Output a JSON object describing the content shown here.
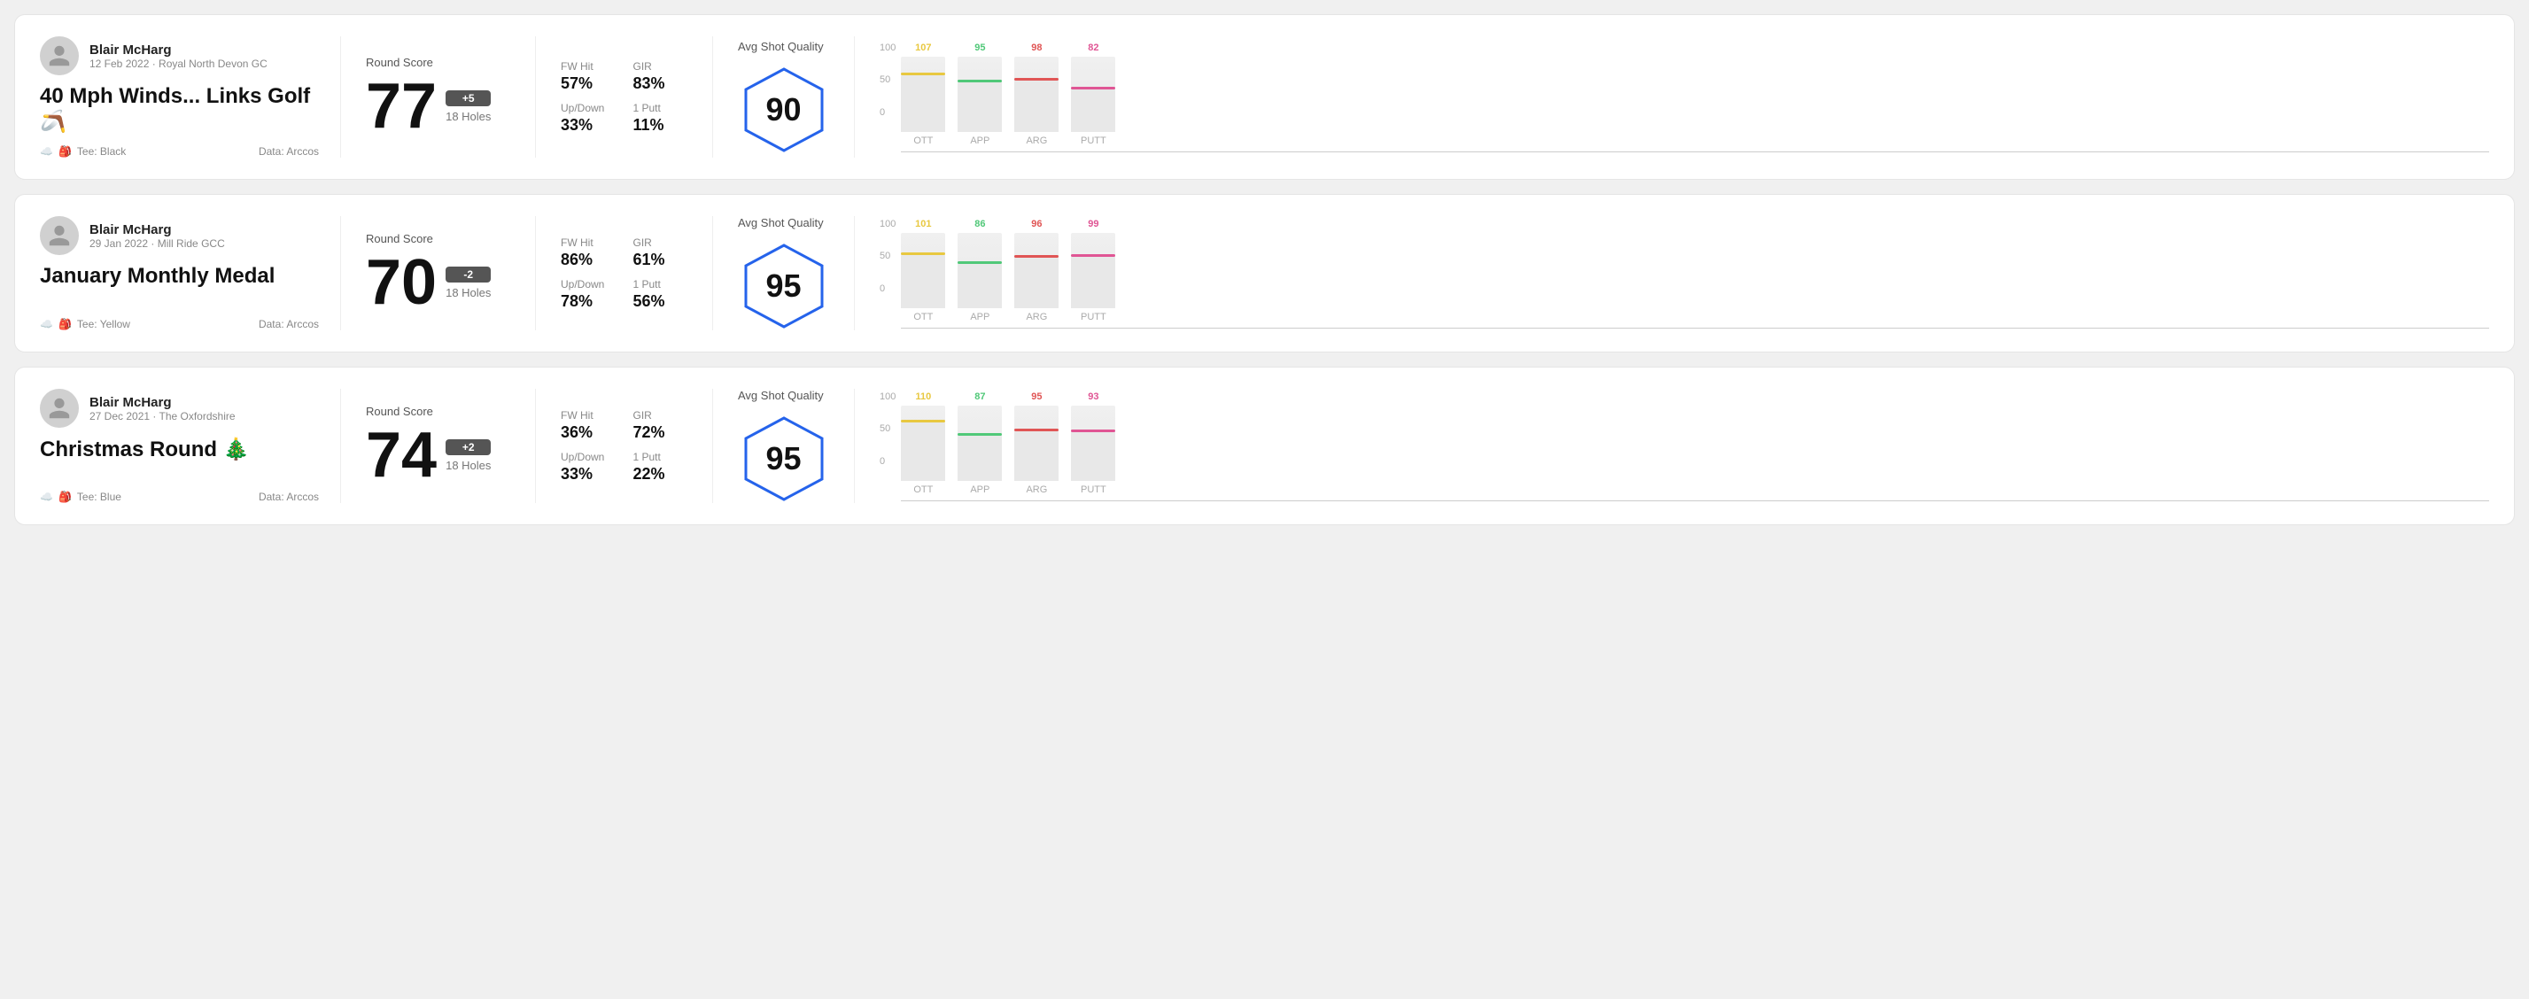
{
  "rounds": [
    {
      "id": "round1",
      "user": {
        "name": "Blair McHarg",
        "meta": "12 Feb 2022 · Royal North Devon GC"
      },
      "title": "40 Mph Winds... Links Golf 🪃",
      "tee": "Black",
      "data_source": "Data: Arccos",
      "score": "77",
      "score_diff": "+5",
      "holes": "18 Holes",
      "fw_hit": "57%",
      "gir": "83%",
      "up_down": "33%",
      "one_putt": "11%",
      "avg_quality": "90",
      "chart": {
        "ott": {
          "value": 107,
          "color": "#e8c840",
          "bar_pct": 75
        },
        "app": {
          "value": 95,
          "color": "#50c878",
          "bar_pct": 65
        },
        "arg": {
          "value": 98,
          "color": "#e05555",
          "bar_pct": 68
        },
        "putt": {
          "value": 82,
          "color": "#e05594",
          "bar_pct": 56
        }
      }
    },
    {
      "id": "round2",
      "user": {
        "name": "Blair McHarg",
        "meta": "29 Jan 2022 · Mill Ride GCC"
      },
      "title": "January Monthly Medal",
      "tee": "Yellow",
      "data_source": "Data: Arccos",
      "score": "70",
      "score_diff": "-2",
      "holes": "18 Holes",
      "fw_hit": "86%",
      "gir": "61%",
      "up_down": "78%",
      "one_putt": "56%",
      "avg_quality": "95",
      "chart": {
        "ott": {
          "value": 101,
          "color": "#e8c840",
          "bar_pct": 70
        },
        "app": {
          "value": 86,
          "color": "#50c878",
          "bar_pct": 58
        },
        "arg": {
          "value": 96,
          "color": "#e05555",
          "bar_pct": 66
        },
        "putt": {
          "value": 99,
          "color": "#e05594",
          "bar_pct": 68
        }
      }
    },
    {
      "id": "round3",
      "user": {
        "name": "Blair McHarg",
        "meta": "27 Dec 2021 · The Oxfordshire"
      },
      "title": "Christmas Round 🎄",
      "tee": "Blue",
      "data_source": "Data: Arccos",
      "score": "74",
      "score_diff": "+2",
      "holes": "18 Holes",
      "fw_hit": "36%",
      "gir": "72%",
      "up_down": "33%",
      "one_putt": "22%",
      "avg_quality": "95",
      "chart": {
        "ott": {
          "value": 110,
          "color": "#e8c840",
          "bar_pct": 77
        },
        "app": {
          "value": 87,
          "color": "#50c878",
          "bar_pct": 59
        },
        "arg": {
          "value": 95,
          "color": "#e05555",
          "bar_pct": 65
        },
        "putt": {
          "value": 93,
          "color": "#e05594",
          "bar_pct": 64
        }
      }
    }
  ],
  "labels": {
    "round_score": "Round Score",
    "fw_hit": "FW Hit",
    "gir": "GIR",
    "up_down": "Up/Down",
    "one_putt": "1 Putt",
    "avg_shot_quality": "Avg Shot Quality",
    "ott": "OTT",
    "app": "APP",
    "arg": "ARG",
    "putt": "PUTT",
    "y100": "100",
    "y50": "50",
    "y0": "0"
  }
}
